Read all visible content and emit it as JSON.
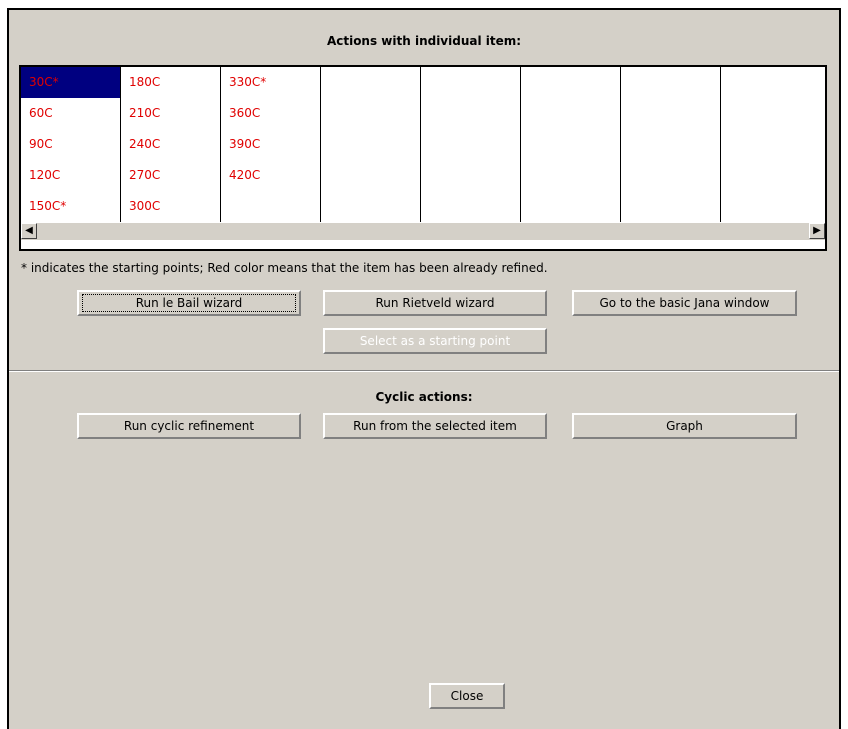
{
  "individual": {
    "title": "Actions with individual item:",
    "grid": [
      [
        "30C*",
        "60C",
        "90C",
        "120C",
        "150C*"
      ],
      [
        "180C",
        "210C",
        "240C",
        "270C",
        "300C"
      ],
      [
        "330C*",
        "360C",
        "390C",
        "420C"
      ],
      [],
      [],
      [],
      [],
      []
    ],
    "selected": "30C*",
    "item_color": "#e00000",
    "selection_color": "#000080",
    "note": "* indicates the starting points; Red color means that the item has been already refined.",
    "buttons": {
      "le_bail": "Run le Bail wizard",
      "rietveld": "Run Rietveld wizard",
      "basic_jana": "Go to the basic Jana window",
      "select_start": "Select as a starting point"
    }
  },
  "cyclic": {
    "title": "Cyclic actions:",
    "buttons": {
      "cyclic_refinement": "Run cyclic refinement",
      "from_selected": "Run from the selected item",
      "graph": "Graph"
    }
  },
  "close_label": "Close",
  "scrollbar": {
    "left_icon": "scroll-left-arrow",
    "right_icon": "scroll-right-arrow"
  }
}
